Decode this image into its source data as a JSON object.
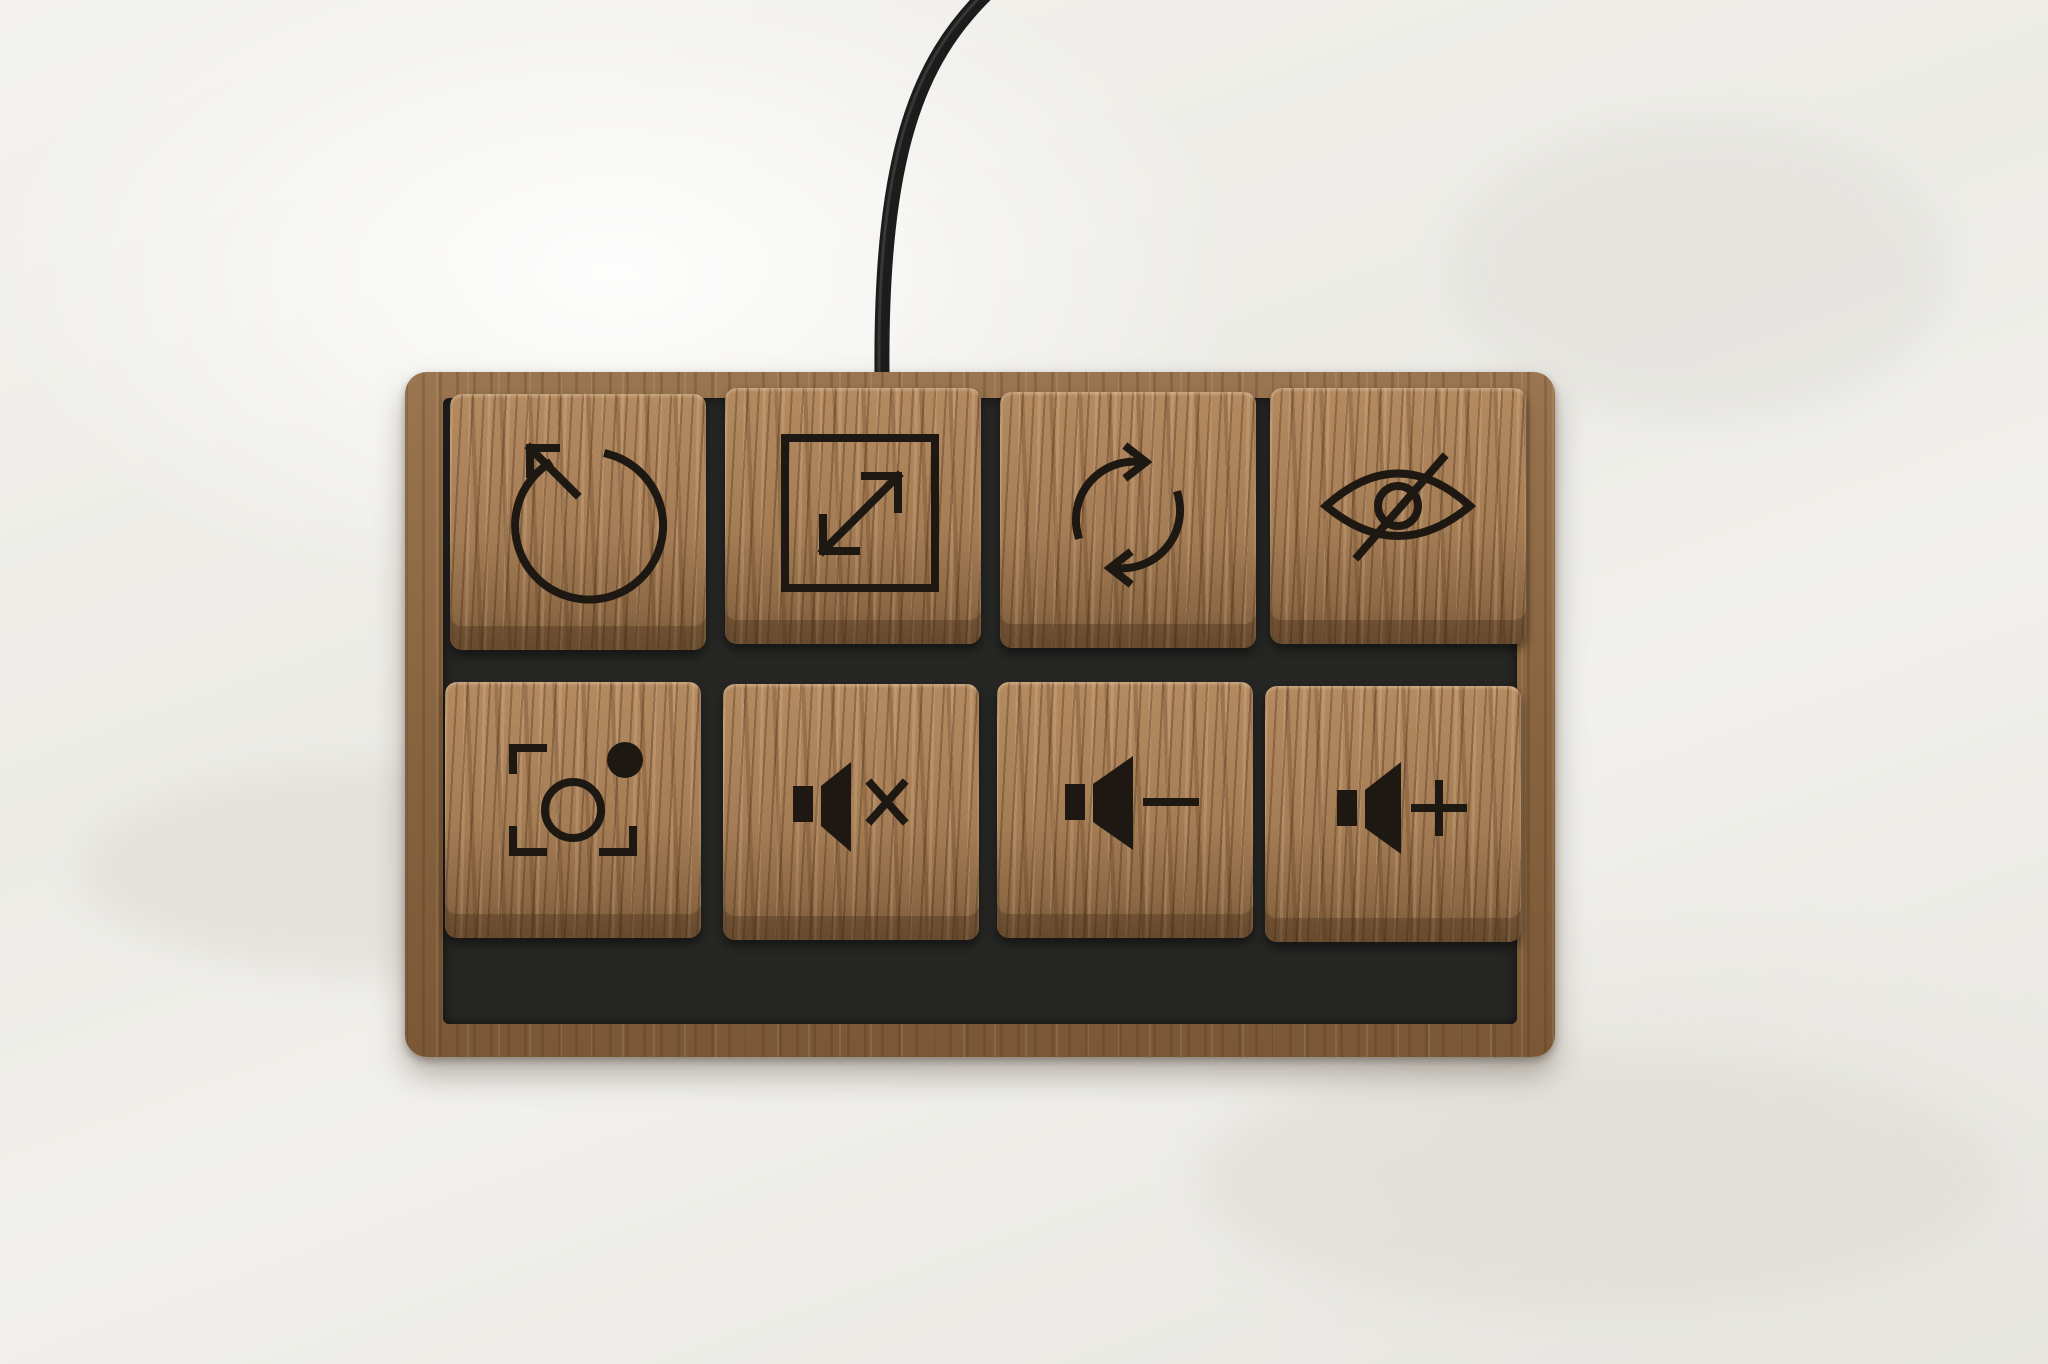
{
  "scene": {
    "subject": "wooden macropad",
    "colors": {
      "background": "#efeee9",
      "wood_light": "#b48a60",
      "wood_dark": "#7a5836",
      "engraving": "#1e1812",
      "cable": "#1c1c1c",
      "plate": "#262624"
    }
  },
  "keys": [
    {
      "icon": "restart-icon"
    },
    {
      "icon": "fullscreen-expand-icon"
    },
    {
      "icon": "refresh-icon"
    },
    {
      "icon": "eye-hidden-icon"
    },
    {
      "icon": "screenshot-icon"
    },
    {
      "icon": "volume-mute-icon"
    },
    {
      "icon": "volume-down-icon"
    },
    {
      "icon": "volume-up-icon"
    }
  ]
}
